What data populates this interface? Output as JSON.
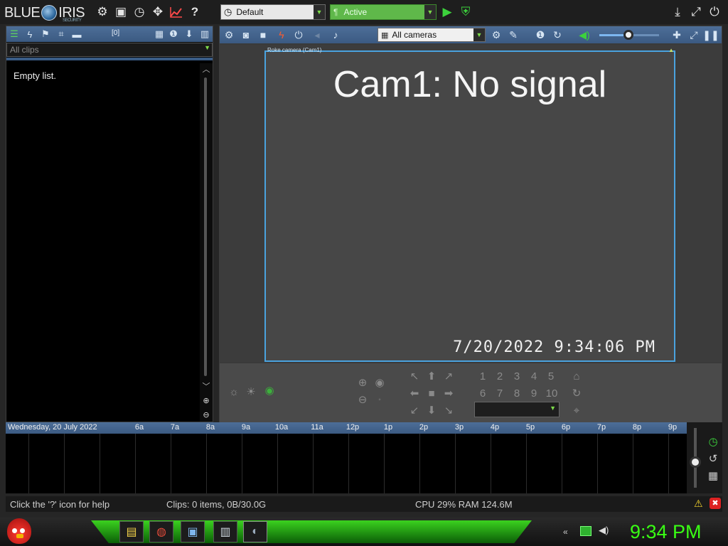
{
  "app": {
    "logo_left": "BLUE",
    "logo_right": "IRIS",
    "logo_sub": "SECURITY"
  },
  "topbar": {
    "profile_dropdown": "Default",
    "schedule_dropdown": "Active"
  },
  "clips_panel": {
    "count_label": "[0]",
    "filter_dropdown": "All clips",
    "empty_text": "Empty list."
  },
  "camera_toolbar": {
    "group_dropdown": "All cameras",
    "volume_level": 0.5
  },
  "camera": {
    "label": "Roke camera (Cam1)",
    "title": "Cam1: No signal",
    "timestamp": "7/20/2022  9:34:06 PM"
  },
  "ptz": {
    "presets": [
      "1",
      "2",
      "3",
      "4",
      "5",
      "6",
      "7",
      "8",
      "9",
      "10"
    ]
  },
  "timeline": {
    "date": "Wednesday, 20 July 2022",
    "hours": [
      "6a",
      "7a",
      "8a",
      "9a",
      "10a",
      "11a",
      "12p",
      "1p",
      "2p",
      "3p",
      "4p",
      "5p",
      "6p",
      "7p",
      "8p",
      "9p"
    ]
  },
  "status": {
    "help": "Click the '?' icon for help",
    "clips": "Clips: 0 items, 0B/30.0G",
    "cpu": "CPU 29% RAM 124.6M"
  },
  "taskbar": {
    "clock": "9:34 PM"
  },
  "colors": {
    "accent_blue": "#4aa3df",
    "active_green": "#5fb84a",
    "clock_green": "#39ff14",
    "toolbar_blue": "#3b5a82"
  }
}
